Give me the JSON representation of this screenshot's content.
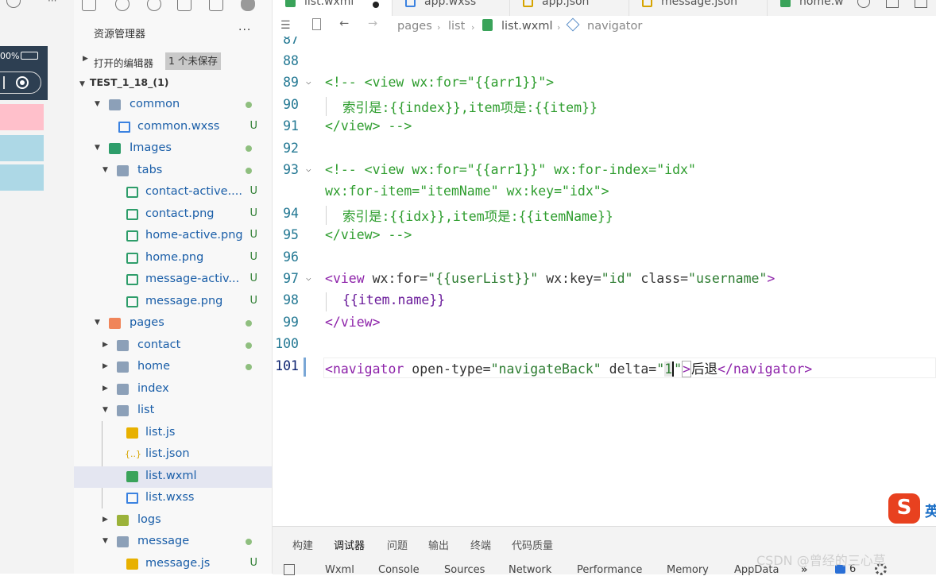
{
  "simulator": {
    "battery": "00%"
  },
  "explorer": {
    "title": "资源管理器",
    "more": "···",
    "open_editors": "打开的编辑器",
    "unsaved_badge": "1 个未保存",
    "project": "TEST_1_18_(1)",
    "tree": [
      {
        "label": "common",
        "status": "dot"
      },
      {
        "label": "common.wxss",
        "status": "U"
      },
      {
        "label": "Images",
        "status": "dot"
      },
      {
        "label": "tabs",
        "status": "dot"
      },
      {
        "label": "contact-active....",
        "status": "U"
      },
      {
        "label": "contact.png",
        "status": "U"
      },
      {
        "label": "home-active.png",
        "status": "U"
      },
      {
        "label": "home.png",
        "status": "U"
      },
      {
        "label": "message-activ...",
        "status": "U"
      },
      {
        "label": "message.png",
        "status": "U"
      },
      {
        "label": "pages",
        "status": "dot"
      },
      {
        "label": "contact",
        "status": "dot"
      },
      {
        "label": "home",
        "status": "dot"
      },
      {
        "label": "index",
        "status": ""
      },
      {
        "label": "list",
        "status": ""
      },
      {
        "label": "list.js",
        "status": ""
      },
      {
        "label": "list.json",
        "status": ""
      },
      {
        "label": "list.wxml",
        "status": ""
      },
      {
        "label": "list.wxss",
        "status": ""
      },
      {
        "label": "logs",
        "status": ""
      },
      {
        "label": "message",
        "status": "dot"
      },
      {
        "label": "message.js",
        "status": "U"
      }
    ]
  },
  "tabs": [
    {
      "label": "list.wxml",
      "icon": "wxml-icon"
    },
    {
      "label": "app.wxss",
      "icon": "wxss-icon"
    },
    {
      "label": "app.json",
      "icon": "json-icon"
    },
    {
      "label": "message.json",
      "icon": "json-icon"
    },
    {
      "label": "home.w",
      "icon": "wxml-icon"
    }
  ],
  "breadcrumb": [
    "pages",
    "list",
    "list.wxml",
    "navigator"
  ],
  "code": {
    "line_numbers": [
      "87",
      "88",
      "89",
      "90",
      "91",
      "92",
      "93",
      "94",
      "95",
      "96",
      "97",
      "98",
      "99",
      "100",
      "101"
    ],
    "l89": "<!-- <view wx:for=\"{{arr1}}\">",
    "l90": "索引是:{{index}},item项是:{{item}}",
    "l91": "</view> -->",
    "l93": "<!-- <view wx:for=\"{{arr1}}\" wx:for-index=\"idx\"",
    "l93b": "wx:for-item=\"itemName\" wx:key=\"idx\">",
    "l94": "索引是:{{idx}},item项是:{{itemName}}",
    "l95": "</view> -->",
    "l97": {
      "open": "<",
      "tag": "view",
      "sp1": " ",
      "a1": "wx:for=",
      "s1": "\"{{userList}}\"",
      "sp2": " ",
      "a2": "wx:key=",
      "s2": "\"id\"",
      "sp3": " ",
      "a3": "class=",
      "s3": "\"username\"",
      "close": ">"
    },
    "l98": "{{item.name}}",
    "l99": {
      "open": "</",
      "tag": "view",
      "close": ">"
    },
    "l101": {
      "open": "<",
      "tag": "navigator",
      "sp1": " ",
      "a1": "open-type=",
      "s1": "\"navigateBack\"",
      "sp2": " ",
      "a2": "delta=",
      "s2a": "\"",
      "s2b": "1",
      "s2c": "\"",
      "close": ">",
      "text": "后退",
      "copen": "</",
      "ctag": "navigator",
      "cclose": ">"
    }
  },
  "panel": {
    "tabs": [
      "构建",
      "调试器",
      "问题",
      "输出",
      "终端",
      "代码质量"
    ],
    "subtabs": [
      "Wxml",
      "Console",
      "Sources",
      "Network",
      "Performance",
      "Memory",
      "AppData",
      "»"
    ],
    "badge": "6"
  },
  "watermark": "CSDN @曾经的三心草",
  "ime": {
    "logo": "S",
    "text": "英"
  }
}
